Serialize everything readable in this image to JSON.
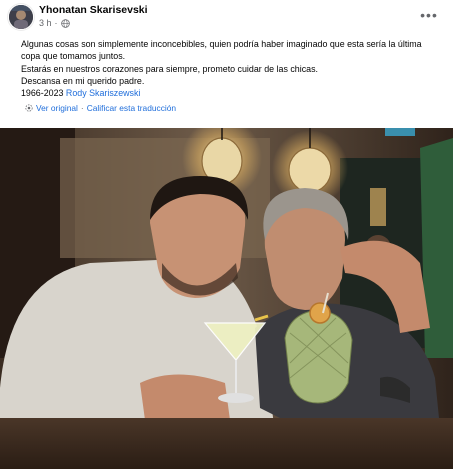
{
  "post": {
    "author_name": "Yhonatan Skarisevski",
    "timestamp": "3 h",
    "visibility_icon": "globe-icon",
    "more_icon": "more-options-icon",
    "more_label": "•••",
    "body": {
      "line1": "Algunas cosas son simplemente inconcebibles, quien podría haber imaginado que esta sería la última",
      "line2": "copa que tomamos juntos.",
      "line3": "Estarás en nuestros corazones para siempre, prometo cuidar de las chicas.",
      "line4": "Descansa en mi querido padre.",
      "years": "1966-2023",
      "tagged_name": "Rody Skariszewski"
    },
    "translation": {
      "icon": "translate-icon",
      "see_original": "Ver original",
      "separator": "·",
      "rate_translation": "Calificar esta traducción"
    }
  },
  "colors": {
    "link": "#216fdb",
    "meta": "#65676b",
    "text": "#050505"
  }
}
